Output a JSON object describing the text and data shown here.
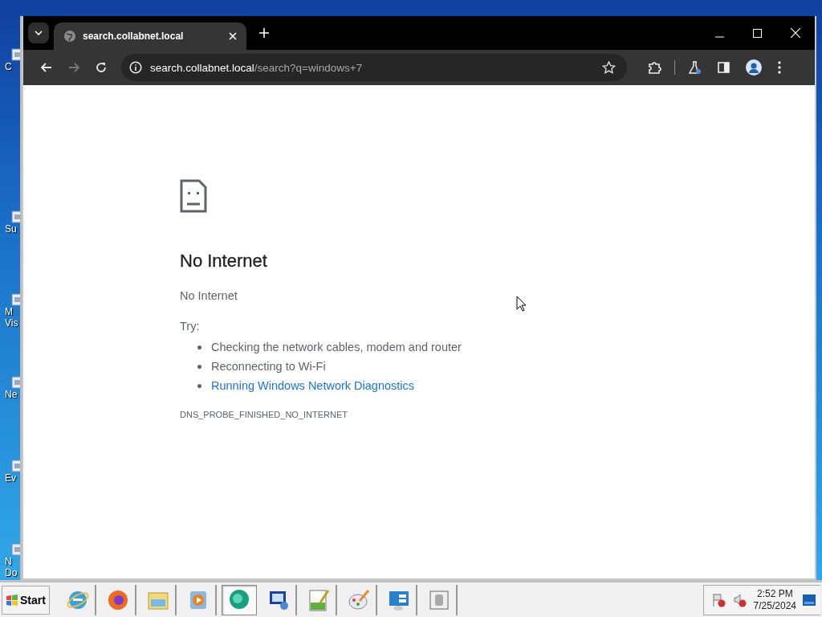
{
  "desktop_icons": [
    {
      "lines": [
        "C"
      ]
    },
    {
      "lines": [
        "Su"
      ]
    },
    {
      "lines": [
        "M",
        "Vis"
      ]
    },
    {
      "lines": [
        "Ne"
      ]
    },
    {
      "lines": [
        "Ev"
      ]
    },
    {
      "lines": [
        "N",
        "Do"
      ]
    }
  ],
  "browser": {
    "tab": {
      "title": "search.collabnet.local",
      "selected": true
    },
    "address": {
      "host": "search.collabnet.local",
      "path": "/search?q=windows+7"
    }
  },
  "page": {
    "heading": "No Internet",
    "subtitle": "No Internet",
    "try_label": "Try:",
    "suggestions": [
      {
        "text": "Checking the network cables, modem and router",
        "kind": "text"
      },
      {
        "text": "Reconnecting to Wi-Fi",
        "kind": "text"
      },
      {
        "text": "Running Windows Network Diagnostics",
        "kind": "link"
      }
    ],
    "error_code": "DNS_PROBE_FINISHED_NO_INTERNET"
  },
  "taskbar": {
    "start": "Start",
    "apps": [
      {
        "kind": "ie",
        "selected": false
      },
      {
        "kind": "firefox",
        "selected": false
      },
      {
        "kind": "folder",
        "selected": false
      },
      {
        "kind": "media",
        "selected": false
      },
      {
        "kind": "chat",
        "selected": true
      },
      {
        "kind": "monitor",
        "selected": false
      },
      {
        "kind": "editor",
        "selected": false
      },
      {
        "kind": "paint",
        "selected": false
      },
      {
        "kind": "panel",
        "selected": false
      },
      {
        "kind": "disk",
        "selected": false
      }
    ],
    "time": "2:52 PM",
    "date": "7/25/2024"
  }
}
